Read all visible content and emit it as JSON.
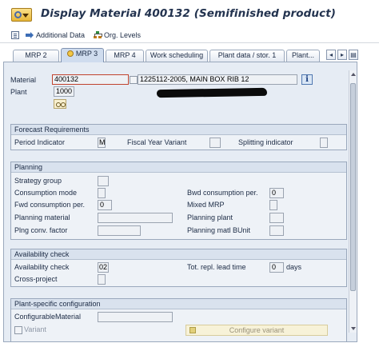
{
  "window": {
    "title": "Display Material 400132 (Semifinished product)",
    "icon": "sap-menu-icon"
  },
  "toolbar": {
    "additional_data": "Additional Data",
    "org_levels": "Org. Levels"
  },
  "tabs": [
    {
      "label": "MRP 2",
      "active": false
    },
    {
      "label": "MRP 3",
      "active": true
    },
    {
      "label": "MRP 4",
      "active": false
    },
    {
      "label": "Work scheduling",
      "active": false
    },
    {
      "label": "Plant data / stor. 1",
      "active": false
    },
    {
      "label": "Plant...",
      "active": false
    }
  ],
  "header": {
    "material_label": "Material",
    "material_value": "400132",
    "material_desc": "1225112-2005,  MAIN BOX RIB 12",
    "plant_label": "Plant",
    "plant_value": "1000"
  },
  "forecast": {
    "title": "Forecast Requirements",
    "period_indicator_label": "Period Indicator",
    "period_indicator_value": "M",
    "fiscal_year_variant_label": "Fiscal Year Variant",
    "fiscal_year_variant_value": "",
    "splitting_indicator_label": "Splitting indicator",
    "splitting_indicator_value": ""
  },
  "planning": {
    "title": "Planning",
    "strategy_group_label": "Strategy group",
    "consumption_mode_label": "Consumption mode",
    "fwd_consumption_label": "Fwd consumption per.",
    "fwd_consumption_value": "0",
    "planning_material_label": "Planning material",
    "plng_conv_factor_label": "Plng conv. factor",
    "bwd_consumption_label": "Bwd consumption per.",
    "bwd_consumption_value": "0",
    "mixed_mrp_label": "Mixed MRP",
    "planning_plant_label": "Planning plant",
    "planning_matl_bunit_label": "Planning matl BUnit"
  },
  "availability": {
    "title": "Availability check",
    "availability_check_label": "Availability check",
    "availability_check_value": "02",
    "cross_project_label": "Cross-project",
    "tot_repl_lead_time_label": "Tot. repl. lead time",
    "tot_repl_lead_time_value": "0",
    "days_label": "days"
  },
  "plant_config": {
    "title": "Plant-specific configuration",
    "configurable_material_label": "ConfigurableMaterial",
    "variant_label": "Variant",
    "configure_variant_label": "Configure variant"
  }
}
